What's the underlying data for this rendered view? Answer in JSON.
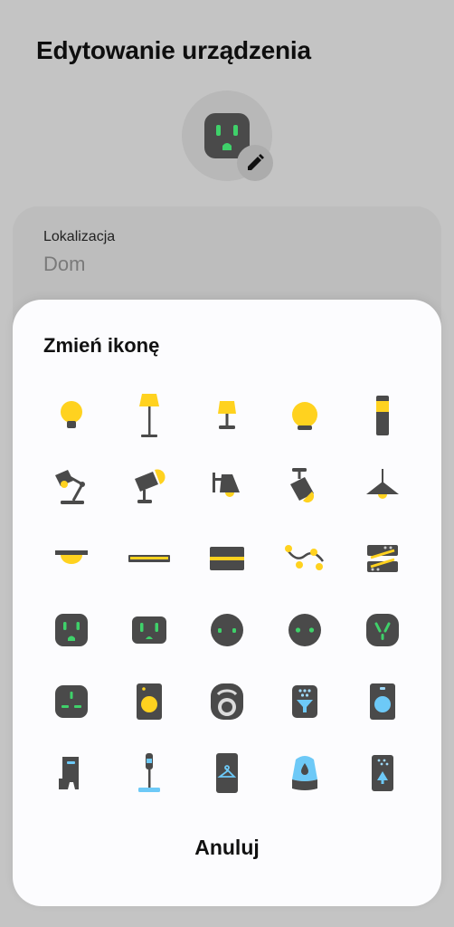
{
  "screen": {
    "title": "Edytowanie urządzenia"
  },
  "device": {
    "current_icon": "smart-plug-icon",
    "edit_icon": "pencil-icon"
  },
  "location": {
    "label": "Lokalizacja",
    "value": "Dom"
  },
  "dialog": {
    "title": "Zmień ikonę",
    "cancel_label": "Anuluj",
    "icons": [
      "bulb-icon",
      "floor-lamp-icon",
      "table-lamp-icon",
      "round-bulb-icon",
      "light-tube-icon",
      "desk-lamp-icon",
      "spotlight-icon",
      "wall-lamp-icon",
      "ceiling-spotlight-icon",
      "pendant-lamp-icon",
      "ceiling-light-icon",
      "light-bar-icon",
      "light-panel-icon",
      "string-lights-icon",
      "led-strip-icon",
      "plug-type-a-icon",
      "plug-type-b-icon",
      "plug-round-icon",
      "plug-round-2-icon",
      "plug-type-i-icon",
      "plug-type-g-icon",
      "speaker-box-icon",
      "robot-vacuum-icon",
      "air-purifier-icon",
      "washing-machine-icon",
      "boot-dryer-icon",
      "stick-vacuum-icon",
      "clothes-care-icon",
      "humidifier-icon",
      "shoe-care-icon"
    ]
  },
  "colors": {
    "icon_dark": "#4a4a4a",
    "accent_yellow": "#ffd21f",
    "accent_green": "#3fd16a",
    "accent_blue": "#6dc9f7",
    "scrim": "#c4c4c4"
  }
}
